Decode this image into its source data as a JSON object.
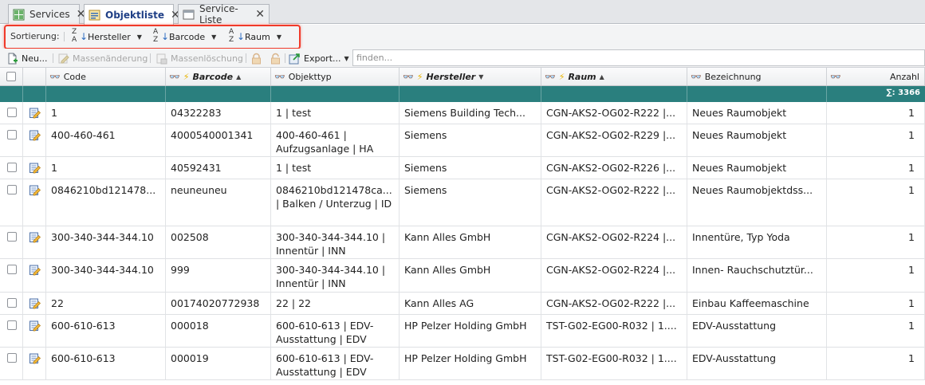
{
  "tabs": [
    {
      "label": "Services",
      "icon": "grid-icon"
    },
    {
      "label": "Objektliste",
      "icon": "list-icon"
    },
    {
      "label": "Service-Liste",
      "icon": "window-icon"
    }
  ],
  "sortbar": {
    "label": "Sortierung:",
    "items": [
      {
        "label": "Hersteller",
        "letters": [
          "Z",
          "A"
        ],
        "direction": "descending"
      },
      {
        "label": "Barcode",
        "letters": [
          "A",
          "Z"
        ],
        "direction": "ascending"
      },
      {
        "label": "Raum",
        "letters": [
          "A",
          "Z"
        ],
        "direction": "ascending"
      }
    ]
  },
  "toolbar": {
    "new_label": "Neu...",
    "mass_edit_label": "Massenänderung",
    "mass_delete_label": "Massenlöschung",
    "export_label": "Export...",
    "search_placeholder": "finden..."
  },
  "columns": [
    {
      "label": "Code",
      "sort": ""
    },
    {
      "label": "Barcode",
      "sort": "▲"
    },
    {
      "label": "Objekttyp",
      "sort": ""
    },
    {
      "label": "Hersteller",
      "sort": "▼"
    },
    {
      "label": "Raum",
      "sort": "▲"
    },
    {
      "label": "Bezeichnung",
      "sort": ""
    },
    {
      "label": "Anzahl",
      "sort": ""
    }
  ],
  "summary": {
    "anzahl": "∑: 3366"
  },
  "rows": [
    {
      "code": "1",
      "barcode": "04322283",
      "objekttyp": "1 | test",
      "hersteller": "Siemens Building Tech...",
      "raum": "CGN-AKS2-OG02-R222 |...",
      "bezeichnung": "Neues Raumobjekt",
      "anzahl": "1"
    },
    {
      "code": "400-460-461",
      "barcode": "4000540001341",
      "objekttyp": "400-460-461 | Aufzugsanlage | HA",
      "hersteller": "Siemens",
      "raum": "CGN-AKS2-OG02-R229 |...",
      "bezeichnung": "Neues Raumobjekt",
      "anzahl": "1"
    },
    {
      "code": "1",
      "barcode": "40592431",
      "objekttyp": "1 | test",
      "hersteller": "Siemens",
      "raum": "CGN-AKS2-OG02-R226 |...",
      "bezeichnung": "Neues Raumobjekt",
      "anzahl": "1"
    },
    {
      "code": "0846210bd121478...",
      "barcode": "neuneuneu",
      "objekttyp": "0846210bd121478ca... | Balken / Unterzug | ID",
      "hersteller": "Siemens",
      "raum": "CGN-AKS2-OG02-R222 |...",
      "bezeichnung": "Neues Raumobjektdss...",
      "anzahl": "1"
    },
    {
      "code": "300-340-344-344.10",
      "barcode": "002508",
      "objekttyp": "300-340-344-344.10 | Innentür | INN",
      "hersteller": "Kann Alles GmbH",
      "raum": "CGN-AKS2-OG02-R224 |...",
      "bezeichnung": "Innentüre, Typ Yoda",
      "anzahl": "1"
    },
    {
      "code": "300-340-344-344.10",
      "barcode": "999",
      "objekttyp": "300-340-344-344.10 | Innentür | INN",
      "hersteller": "Kann Alles GmbH",
      "raum": "CGN-AKS2-OG02-R224 |...",
      "bezeichnung": "Innen- Rauchschutztür...",
      "anzahl": "1"
    },
    {
      "code": "22",
      "barcode": "00174020772938",
      "objekttyp": "22 | 22",
      "hersteller": "Kann Alles AG",
      "raum": "CGN-AKS2-OG02-R222 |...",
      "bezeichnung": "Einbau Kaffeemaschine",
      "anzahl": "1"
    },
    {
      "code": "600-610-613",
      "barcode": "000018",
      "objekttyp": "600-610-613 | EDV-Ausstattung | EDV",
      "hersteller": "HP Pelzer Holding GmbH",
      "raum": "TST-G02-EG00-R032 | 1....",
      "bezeichnung": "EDV-Ausstattung",
      "anzahl": "1"
    },
    {
      "code": "600-610-613",
      "barcode": "000019",
      "objekttyp": "600-610-613 | EDV-Ausstattung | EDV",
      "hersteller": "HP Pelzer Holding GmbH",
      "raum": "TST-G02-EG00-R032 | 1....",
      "bezeichnung": "EDV-Ausstattung",
      "anzahl": "1"
    }
  ],
  "colors": {
    "accent": "#2a7f7e",
    "highlight": "#f03a2a",
    "title": "#1f3f86"
  }
}
